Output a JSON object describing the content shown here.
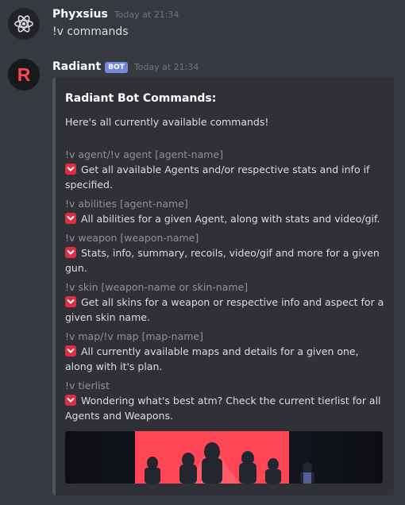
{
  "messages": [
    {
      "username": "Phyxsius",
      "timestamp": "Today at 21:34",
      "text": "!v commands",
      "avatar_icon": "atom-icon"
    },
    {
      "username": "Radiant",
      "bot_tag": "BOT",
      "timestamp": "Today at 21:34",
      "avatar_icon": "radiant-logo-icon",
      "avatar_letter": "R"
    }
  ],
  "embed": {
    "title": "Radiant Bot Commands:",
    "description": "Here's all currently available commands!",
    "commands": [
      {
        "name": "!v agent/!v agent [agent-name]",
        "description": "Get all available Agents and/or respective stats and info if specified."
      },
      {
        "name": "!v abilities [agent-name]",
        "description": "All abilities for a given Agent, along with stats and video/gif."
      },
      {
        "name": "!v weapon [weapon-name]",
        "description": "Stats, info, summary, recoils, video/gif and more for a given gun."
      },
      {
        "name": "!v skin [weapon-name or skin-name]",
        "description": "Get all skins for a weapon or respective info and aspect for a given skin name."
      },
      {
        "name": "!v map/!v map [map-name]",
        "description": "All currently available maps and details for a given one, along with it's plan."
      },
      {
        "name": "!v tierlist",
        "description": "Wondering what's best atm? Check the current tierlist for all Agents and Weapons."
      }
    ],
    "bullet_icon": "red-chevron-down-emoji",
    "image_icon": "valorant-agents-banner"
  },
  "colors": {
    "background": "#36393f",
    "embed_bg": "#2f3136",
    "bot_tag": "#7289da",
    "accent_red": "#dd2e44",
    "radiant_red": "#ff4655"
  }
}
